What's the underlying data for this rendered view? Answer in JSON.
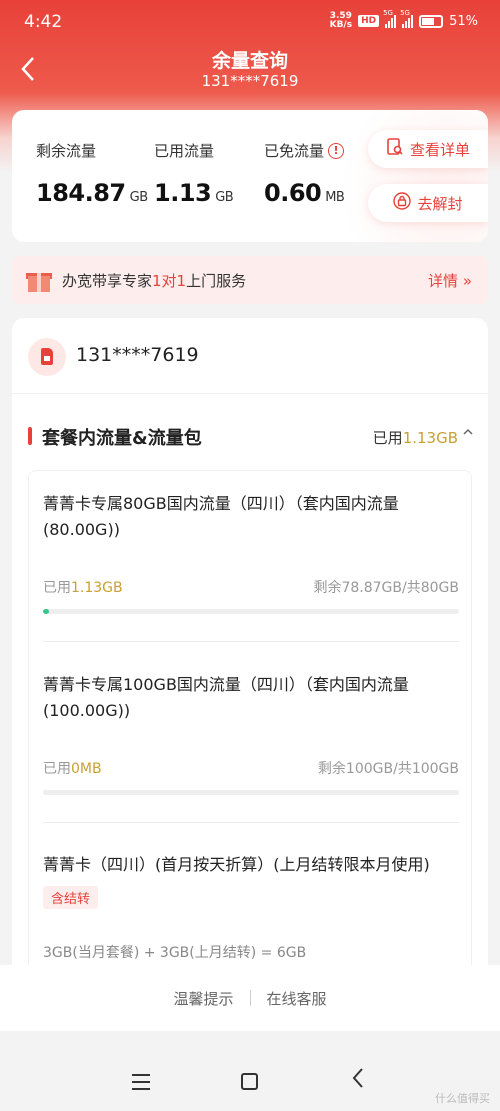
{
  "status_bar": {
    "time": "4:42",
    "net_speed_value": "3.59",
    "net_speed_unit": "KB/s",
    "hd_badge": "HD",
    "signal_tag_1": "5G",
    "signal_tag_2": "5G",
    "battery": "51"
  },
  "nav": {
    "title": "余量查询",
    "subtitle": "131****7619"
  },
  "summary": {
    "remaining_label": "剩余流量",
    "remaining_value": "184.87",
    "remaining_unit": "GB",
    "used_label": "已用流量",
    "used_value": "1.13",
    "used_unit": "GB",
    "free_label": "已免流量",
    "free_value": "0.60",
    "free_unit": "MB",
    "detail_btn": "查看详单",
    "unseal_btn": "去解封"
  },
  "promo": {
    "text_before": "办宽带享专家",
    "text_highlight": "1对1",
    "text_after": "上门服务",
    "more": "详情 »"
  },
  "account": {
    "phone": "131****7619"
  },
  "section": {
    "title": "套餐内流量&流量包",
    "used_label": "已用",
    "used_value": "1.13GB"
  },
  "packages": [
    {
      "name": "菁菁卡专属80GB国内流量（四川）（套内国内流量(80.00G))",
      "used_label": "已用",
      "used_value": "1.13GB",
      "remaining": "剩余78.87GB/共80GB",
      "progress": 0.014
    },
    {
      "name": "菁菁卡专属100GB国内流量（四川）（套内国内流量(100.00G))",
      "used_label": "已用",
      "used_value": "0MB",
      "remaining": "剩余100GB/共100GB",
      "progress": 0
    },
    {
      "name": "菁菁卡（四川）(首月按天折算）(上月结转限本月使用)",
      "tag": "含结转",
      "formula": "3GB(当月套餐) + 3GB(上月结转) = 6GB"
    }
  ],
  "footer": {
    "tips": "温馨提示",
    "service": "在线客服"
  },
  "watermark": "什么值得买",
  "colors": {
    "primary": "#e8413a",
    "gold": "#c9a033",
    "progress": "#3cc48c"
  }
}
